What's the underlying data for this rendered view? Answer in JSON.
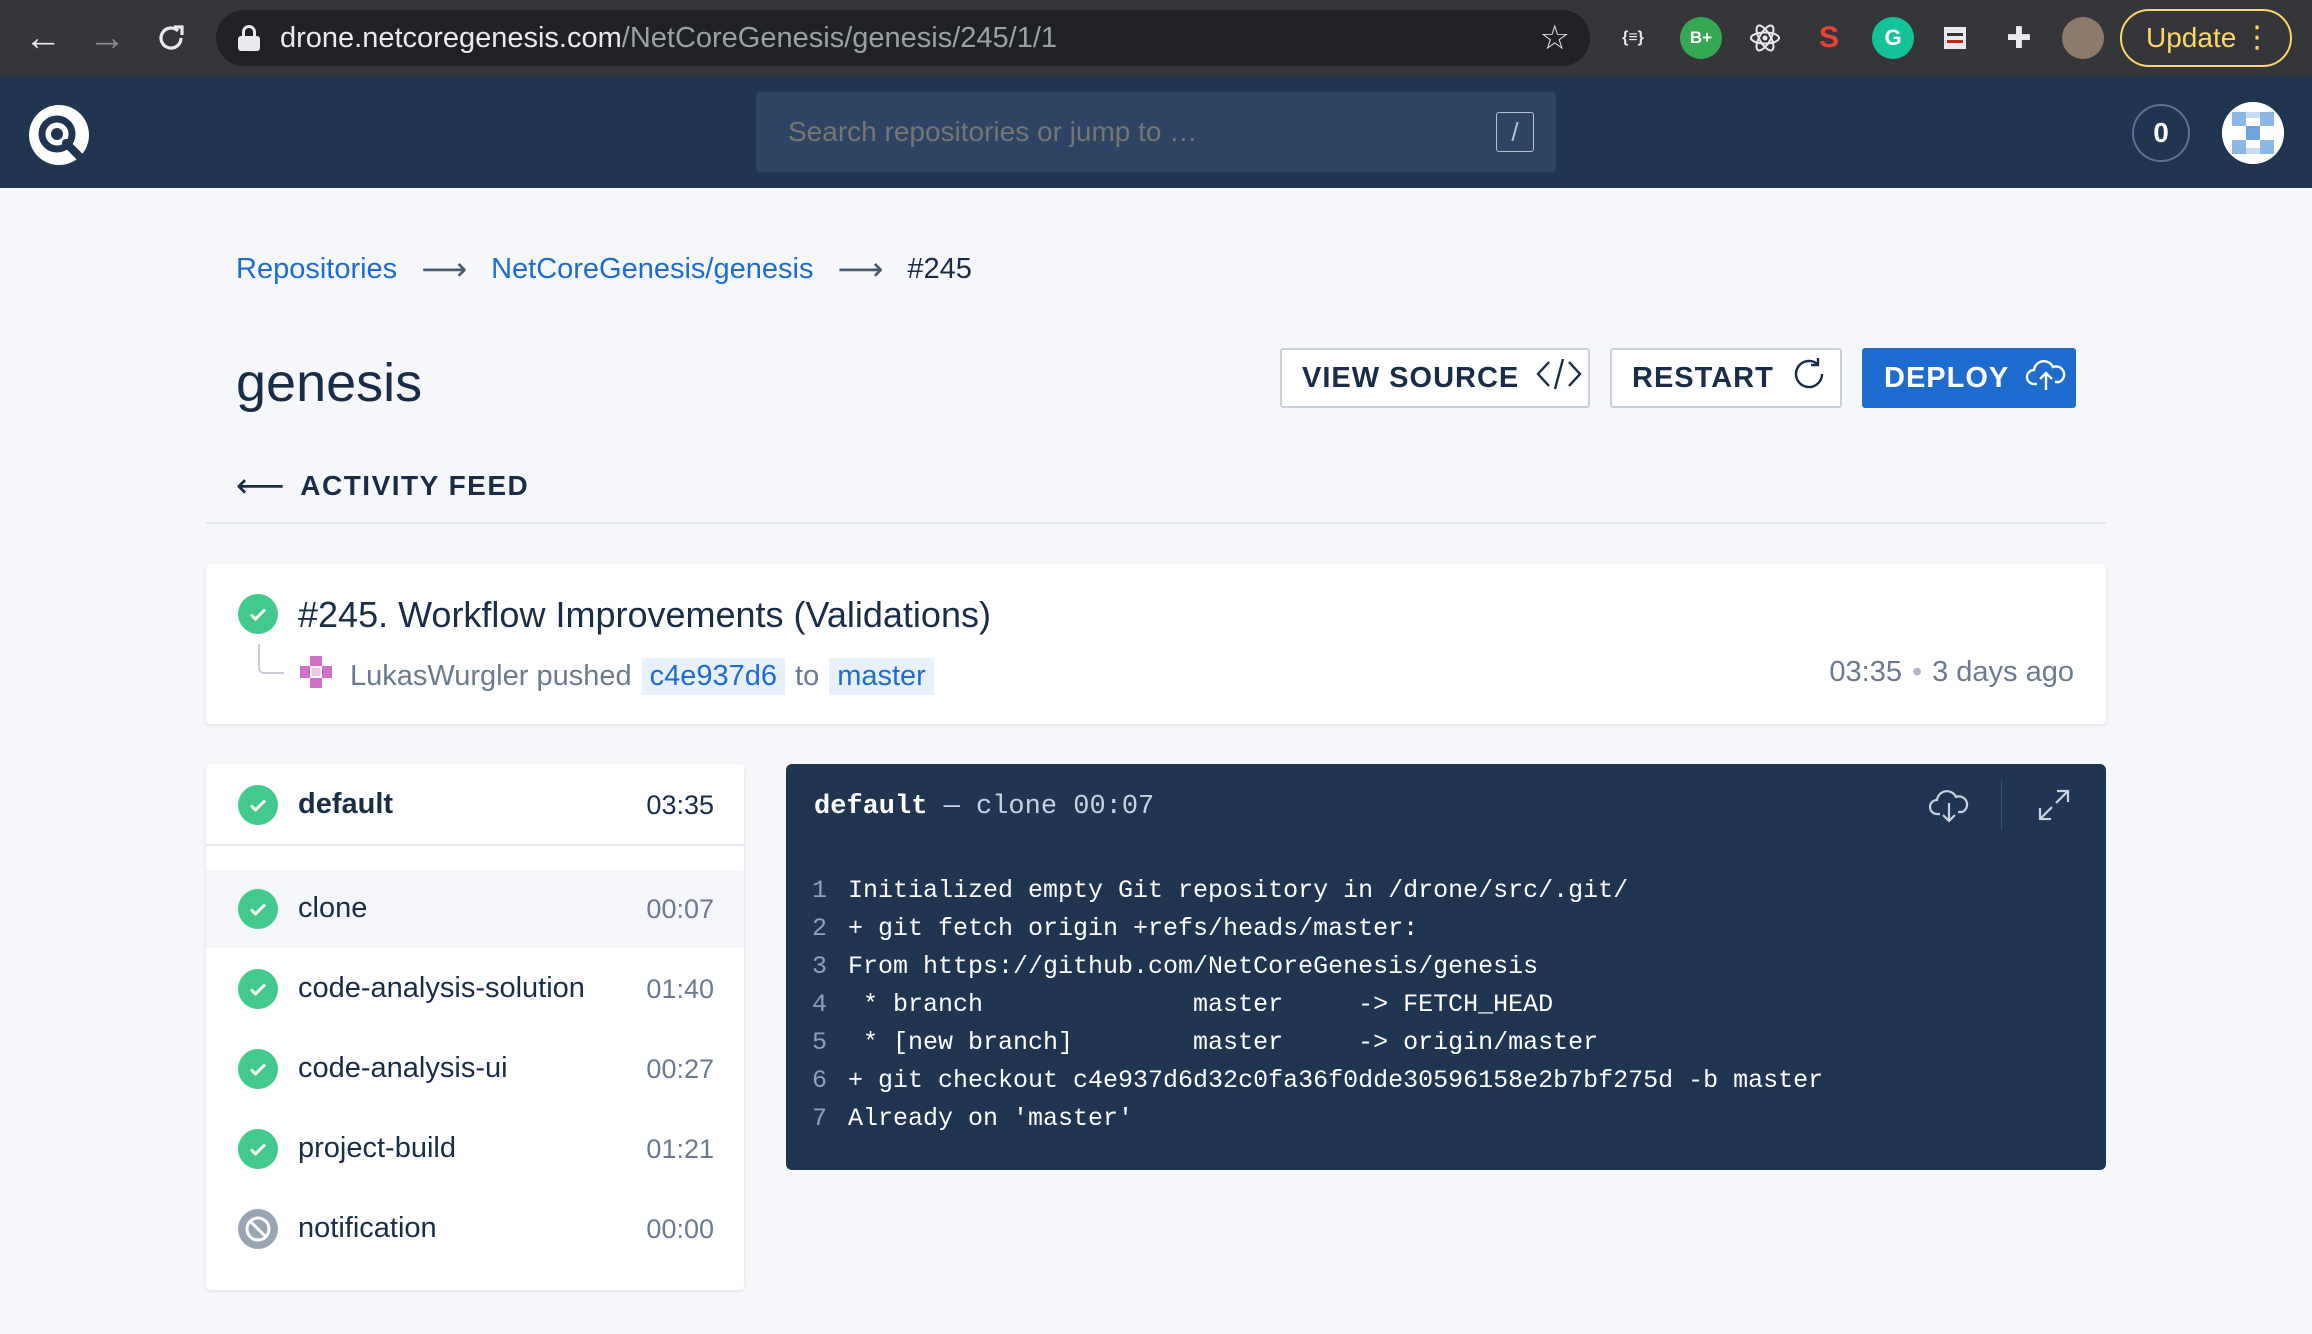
{
  "browser": {
    "url_host": "drone.netcoregenesis.com",
    "url_path": "/NetCoreGenesis/genesis/245/1/1",
    "update_label": "Update",
    "extensions": [
      "json-viewer-icon",
      "bplus-icon",
      "react-icon",
      "seo-icon",
      "grammarly-icon",
      "ext-icon",
      "puzzle-icon"
    ]
  },
  "header": {
    "search_placeholder": "Search repositories or jump to …",
    "search_shortcut": "/",
    "notification_count": "0"
  },
  "breadcrumb": {
    "items": [
      "Repositories",
      "NetCoreGenesis/genesis",
      "#245"
    ]
  },
  "repo": {
    "title": "genesis"
  },
  "actions": {
    "view_source": "VIEW SOURCE",
    "restart": "RESTART",
    "deploy": "DEPLOY"
  },
  "activity_feed_label": "ACTIVITY FEED",
  "build": {
    "title": "#245. Workflow Improvements (Validations)",
    "author": "LukasWurgler",
    "action": "pushed",
    "commit": "c4e937d6",
    "to_label": "to",
    "branch": "master",
    "duration": "03:35",
    "time_ago": "3 days ago"
  },
  "stage": {
    "name": "default",
    "duration": "03:35",
    "steps": [
      {
        "name": "clone",
        "duration": "00:07",
        "status": "success"
      },
      {
        "name": "code-analysis-solution",
        "duration": "01:40",
        "status": "success"
      },
      {
        "name": "code-analysis-ui",
        "duration": "00:27",
        "status": "success"
      },
      {
        "name": "project-build",
        "duration": "01:21",
        "status": "success"
      },
      {
        "name": "notification",
        "duration": "00:00",
        "status": "skipped"
      }
    ]
  },
  "log": {
    "stage": "default",
    "dash": "—",
    "step": "clone",
    "duration": "00:07",
    "lines": [
      {
        "n": "1",
        "text": "Initialized empty Git repository in /drone/src/.git/"
      },
      {
        "n": "2",
        "text": "+ git fetch origin +refs/heads/master:"
      },
      {
        "n": "3",
        "text": "From https://github.com/NetCoreGenesis/genesis"
      },
      {
        "n": "4",
        "text": " * branch              master     -> FETCH_HEAD"
      },
      {
        "n": "5",
        "text": " * [new branch]        master     -> origin/master"
      },
      {
        "n": "6",
        "text": "+ git checkout c4e937d6d32c0fa36f0dde30596158e2b7bf275d -b master"
      },
      {
        "n": "7",
        "text": "Already on 'master'"
      }
    ]
  },
  "colors": {
    "header_bg": "#1f3552",
    "accent": "#1e6ccf",
    "success": "#42c98d",
    "skipped": "#9aa5b4"
  }
}
